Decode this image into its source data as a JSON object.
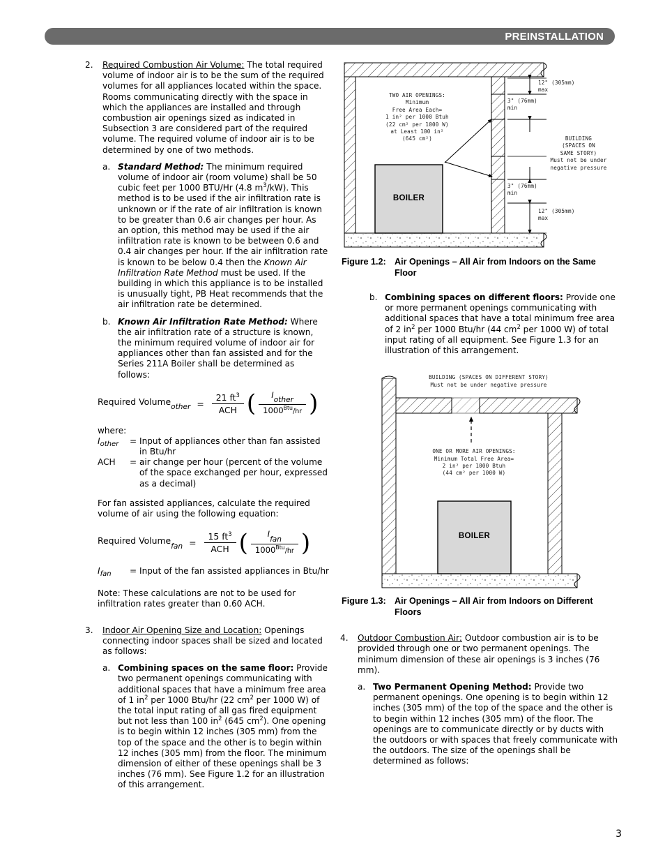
{
  "header": {
    "title": "PREINSTALLATION"
  },
  "page_number": "3",
  "left_column": {
    "item2": {
      "marker": "2.",
      "lead": "Required Combustion Air Volume:",
      "body": " The total required volume of indoor air is to be the sum of the required volumes for all appliances located within the space. Rooms communicating directly with the space in which the appliances are installed and through combustion air openings sized as indicated in Subsection 3 are considered part of the required volume. The required volume of indoor air is to be determined by one of two methods.",
      "sub_a": {
        "marker": "a.",
        "lead": "Standard Method:",
        "body_1": " The minimum required volume of indoor air (room volume) shall be 50 cubic feet per 1000 BTU/Hr (4.8 m",
        "sup_1": "3",
        "body_2": "/kW). This method is to be used if the air infiltration rate is unknown or if the rate of air infiltration is known to be greater than 0.6 air changes per hour. As an option, this method may be used if the air infiltration rate is known to be between 0.6 and 0.4 air changes per hour. If the air infiltration rate is known to be below 0.4 then the ",
        "italic_ref": "Known Air Infiltration Rate Method",
        "body_3": " must be used. If the building in which this appliance is to be installed is unusually tight, PB Heat recommends that the air infiltration rate be determined."
      },
      "sub_b": {
        "marker": "b.",
        "lead": "Known Air Infiltration Rate Method:",
        "body": " Where the air infiltration rate of a structure is known, the minimum required volume of indoor air for appliances other than fan assisted and for the Series 211A Boiler shall be determined as follows:"
      }
    },
    "equation_other": {
      "lhs": "Required Volume",
      "lhs_sub": "other",
      "eq": "=",
      "num": "21 ft",
      "num_sup": "3",
      "den": "ACH",
      "frac2_num": "I",
      "frac2_num_sub": "other",
      "frac2_den": "1000",
      "frac2_den_sup": "Btu",
      "frac2_den_unit": "/hr"
    },
    "where_label": "where:",
    "where_rows": [
      {
        "sym": "I",
        "sym_sub": "other",
        "eq": "=",
        "def": "Input of appliances other than fan assisted in Btu/hr"
      },
      {
        "sym": "ACH",
        "sym_sub": "",
        "eq": "=",
        "def": "air change per hour (percent of the volume of the space exchanged per hour, expressed as a decimal)"
      }
    ],
    "fan_intro": "For fan assisted appliances, calculate the required volume of air using the following equation:",
    "equation_fan": {
      "lhs": "Required Volume",
      "lhs_sub": "fan",
      "eq": "=",
      "num": "15 ft",
      "num_sup": "3",
      "den": "ACH",
      "frac2_num": "I",
      "frac2_num_sub": "fan",
      "frac2_den": "1000",
      "frac2_den_sup": "Btu",
      "frac2_den_unit": "/hr"
    },
    "fan_def": {
      "sym": "I",
      "sym_sub": "fan",
      "eq": "=",
      "def": "Input of the fan assisted appliances in Btu/hr"
    },
    "note": "Note:  These calculations are not to be used for infiltration rates greater than 0.60 ACH.",
    "item3": {
      "marker": "3.",
      "lead": "Indoor Air Opening Size and Location:",
      "body": " Openings connecting indoor spaces shall be sized and located as follows:",
      "sub_a": {
        "marker": "a.",
        "lead": "Combining spaces on the same floor:",
        "b1": " Provide two permanent openings communicating with additional spaces that have a minimum free area of 1 in",
        "s1": "2",
        "b2": " per 1000 Btu/hr (22 cm",
        "s2": "2",
        "b3": " per 1000 W) of the total input rating of all gas fired equipment but not less than 100 in",
        "s3": "2",
        "b4": " (645 cm",
        "s4": "2",
        "b5": "). One opening is to begin within 12 inches (305 mm) from the top of the space and the other is to begin within 12 inches (305 mm) from the floor. The minimum dimension of either of these openings shall be 3 inches (76 mm). See Figure 1.2 for an illustration of this arrangement."
      }
    }
  },
  "right_column": {
    "figure_1_2": {
      "caption_label": "Figure 1.2:",
      "caption_text": "Air Openings – All Air from Indoors on the Same Floor",
      "annotation_openings": "TWO AIR OPENINGS:\nMinimum\nFree Area Each=\n1 in² per 1000 Btuh\n(22 cm² per 1000 W)\nat Least 100 in²\n(645 cm²)",
      "label_boiler": "BOILER",
      "dim_top": "12\" (305mm)\nmax",
      "dim_open_upper": "3\" (76mm)\nmin",
      "dim_open_lower": "3\" (76mm)\nmin",
      "dim_bottom": "12\" (305mm)\nmax",
      "note_building": "BUILDING\n(SPACES ON\nSAME STORY)\nMust not be under\nnegative pressure"
    },
    "item3_sub_b": {
      "marker": "b.",
      "lead": "Combining spaces on different floors:",
      "b1": " Provide one or more permanent openings communicating with additional spaces that have a total minimum free area of 2 in",
      "s1": "2",
      "b2": " per 1000 Btu/hr (44 cm",
      "s2": "2",
      "b3": " per 1000 W) of total input rating of all equipment. See Figure 1.3 for an illustration of this arrangement."
    },
    "figure_1_3": {
      "caption_label": "Figure 1.3:",
      "caption_text": "Air Openings – All Air from Indoors on Different Floors",
      "note_building": "BUILDING (SPACES ON DIFFERENT STORY)\nMust not be under negative pressure",
      "annotation_openings": "ONE OR MORE AIR OPENINGS:\nMinimum Total Free Area=\n2 in² per 1000 Btuh\n(44 cm² per 1000 W)",
      "label_boiler": "BOILER"
    },
    "item4": {
      "marker": "4.",
      "lead": "Outdoor Combustion Air:",
      "body": " Outdoor combustion air is to be provided through one or two permanent openings. The minimum dimension of these air openings is 3 inches (76 mm).",
      "sub_a": {
        "marker": "a.",
        "lead": "Two Permanent Opening Method:",
        "body": " Provide two permanent openings. One opening is to begin within 12 inches (305 mm) of the top of the space and the other is to begin within 12 inches (305 mm) of the floor. The openings are to communicate directly or by ducts with the outdoors or with spaces that freely communicate with the outdoors. The size of the openings shall be determined as follows:"
      }
    }
  },
  "colors": {
    "header_bar": "#6b6b6b",
    "boiler_fill": "#d8d8d8",
    "text": "#000000"
  }
}
